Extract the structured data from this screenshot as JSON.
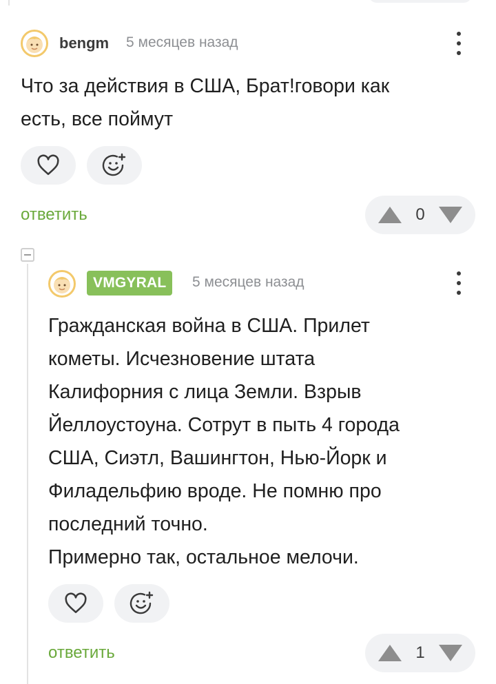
{
  "comment1": {
    "username": "bengm",
    "time": "5 месяцев назад",
    "lines": [
      "Что за действия в США, Брат!говори как",
      "есть, все поймут"
    ],
    "reply_label": "ответить",
    "score": "0"
  },
  "comment2": {
    "username": "VMGYRAL",
    "time": "5 месяцев назад",
    "lines": [
      "Гражданская война в США. Прилет",
      "кометы. Исчезновение штата",
      "Калифорния с лица Земли. Взрыв",
      "Йеллоустоуна. Сотрут в пыть 4 города",
      "США, Сиэтл, Вашингтон, Нью-Йорк и",
      "Филадельфию вроде. Не помню про",
      "последний точно.",
      "Примерно так, остальное мелочи."
    ],
    "reply_label": "ответить",
    "score": "1"
  },
  "colors": {
    "accent_green": "#6aa93b",
    "badge_green": "#88c05a",
    "pill_bg": "#f1f2f4",
    "icon_gray": "#3a3a3a",
    "arrow_gray": "#8d8d8d"
  }
}
